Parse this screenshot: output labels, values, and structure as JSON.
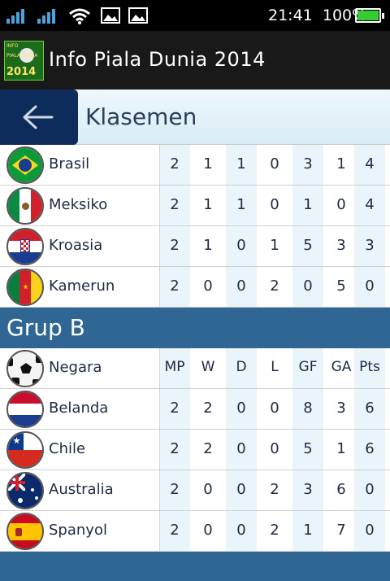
{
  "status_bar": {
    "time": "21:41",
    "battery": "100%",
    "battery_fill": 1.0
  },
  "app_bar": {
    "logo": {
      "line1": "INFO",
      "line2": "PIALA DUNIA",
      "line3": "2014"
    },
    "title": "Info Piala Dunia 2014"
  },
  "section": {
    "back_icon": "arrow-left-icon",
    "title": "Klasemen"
  },
  "groups": [
    {
      "name": "",
      "teams": [
        {
          "name": "Brasil",
          "mp": "2",
          "w": "1",
          "d": "1",
          "l": "0",
          "gf": "3",
          "ga": "1",
          "pts": "4"
        },
        {
          "name": "Meksiko",
          "mp": "2",
          "w": "1",
          "d": "1",
          "l": "0",
          "gf": "1",
          "ga": "0",
          "pts": "4"
        },
        {
          "name": "Kroasia",
          "mp": "2",
          "w": "1",
          "d": "0",
          "l": "1",
          "gf": "5",
          "ga": "3",
          "pts": "3"
        },
        {
          "name": "Kamerun",
          "mp": "2",
          "w": "0",
          "d": "0",
          "l": "2",
          "gf": "0",
          "ga": "5",
          "pts": "0"
        }
      ]
    },
    {
      "name": "Grup B",
      "header": {
        "negara": "Negara",
        "mp": "MP",
        "w": "W",
        "d": "D",
        "l": "L",
        "gf": "GF",
        "ga": "GA",
        "pts": "Pts"
      },
      "teams": [
        {
          "name": "Belanda",
          "mp": "2",
          "w": "2",
          "d": "0",
          "l": "0",
          "gf": "8",
          "ga": "3",
          "pts": "6"
        },
        {
          "name": "Chile",
          "mp": "2",
          "w": "2",
          "d": "0",
          "l": "0",
          "gf": "5",
          "ga": "1",
          "pts": "6"
        },
        {
          "name": "Australia",
          "mp": "2",
          "w": "0",
          "d": "0",
          "l": "2",
          "gf": "3",
          "ga": "6",
          "pts": "0"
        },
        {
          "name": "Spanyol",
          "mp": "2",
          "w": "0",
          "d": "0",
          "l": "2",
          "gf": "1",
          "ga": "7",
          "pts": "0"
        }
      ]
    }
  ]
}
